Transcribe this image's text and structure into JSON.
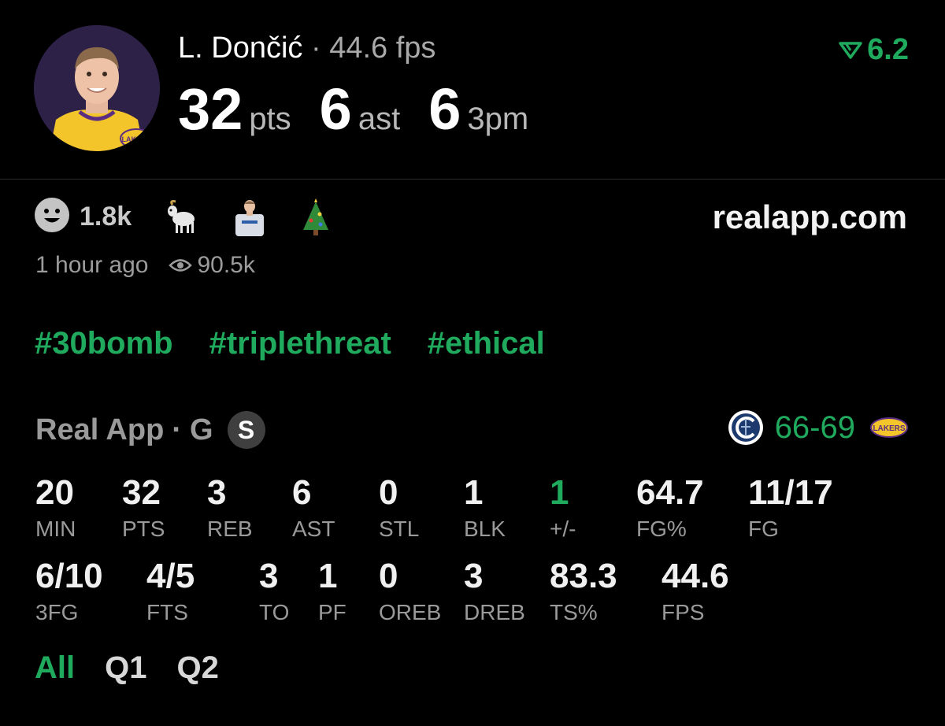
{
  "header": {
    "player_name": "L. Dončić",
    "separator": "·",
    "fps_text": "44.6 fps",
    "stats": [
      {
        "value": "32",
        "unit": "pts"
      },
      {
        "value": "6",
        "unit": "ast"
      },
      {
        "value": "6",
        "unit": "3pm"
      }
    ],
    "rating_value": "6.2",
    "rating_icon": "down-triangle-icon",
    "accent_color": "#1faa5e"
  },
  "reactions": {
    "count": "1.8k",
    "emoji_icons": [
      "smiley-icon",
      "goat-icon",
      "player-photo",
      "christmas-tree-icon"
    ],
    "site": "realapp.com",
    "time_ago": "1 hour ago",
    "views": "90.5k"
  },
  "tags": [
    "#30bomb",
    "#triplethreat",
    "#ethical"
  ],
  "game": {
    "source": "Real App",
    "separator": "·",
    "position": "G",
    "badge": "S",
    "score": "66-69",
    "away_logo": "clippers-logo",
    "home_logo": "lakers-logo"
  },
  "stats_row1": [
    {
      "value": "20",
      "label": "MIN"
    },
    {
      "value": "32",
      "label": "PTS"
    },
    {
      "value": "3",
      "label": "REB"
    },
    {
      "value": "6",
      "label": "AST"
    },
    {
      "value": "0",
      "label": "STL"
    },
    {
      "value": "1",
      "label": "BLK"
    },
    {
      "value": "1",
      "label": "+/-"
    },
    {
      "value": "64.7",
      "label": "FG%"
    },
    {
      "value": "11/17",
      "label": "FG"
    }
  ],
  "stats_row2": [
    {
      "value": "6/10",
      "label": "3FG"
    },
    {
      "value": "4/5",
      "label": "FTS"
    },
    {
      "value": "3",
      "label": "TO"
    },
    {
      "value": "1",
      "label": "PF"
    },
    {
      "value": "0",
      "label": "OREB"
    },
    {
      "value": "3",
      "label": "DREB"
    },
    {
      "value": "83.3",
      "label": "TS%"
    },
    {
      "value": "44.6",
      "label": "FPS"
    }
  ],
  "period_tabs": [
    {
      "label": "All",
      "active": true
    },
    {
      "label": "Q1",
      "active": false
    },
    {
      "label": "Q2",
      "active": false
    }
  ]
}
